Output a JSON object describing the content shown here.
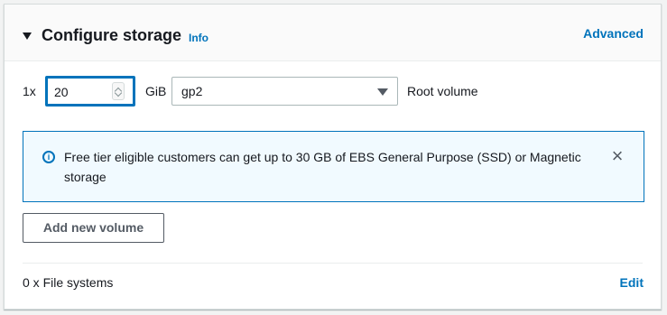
{
  "header": {
    "title": "Configure storage",
    "info_label": "Info",
    "advanced_label": "Advanced"
  },
  "volume": {
    "count_label": "1x",
    "size_value": "20",
    "unit_label": "GiB",
    "type_value": "gp2",
    "volume_label": "Root volume"
  },
  "alert": {
    "message": "Free tier eligible customers can get up to 30 GB of EBS General Purpose (SSD) or Magnetic storage",
    "info_glyph": "i",
    "close_glyph": "×"
  },
  "actions": {
    "add_volume_label": "Add new volume"
  },
  "file_systems": {
    "label": "0 x File systems",
    "edit_label": "Edit"
  },
  "colors": {
    "link": "#0073bb",
    "alert_bg": "#f1faff",
    "alert_border": "#0073bb"
  }
}
